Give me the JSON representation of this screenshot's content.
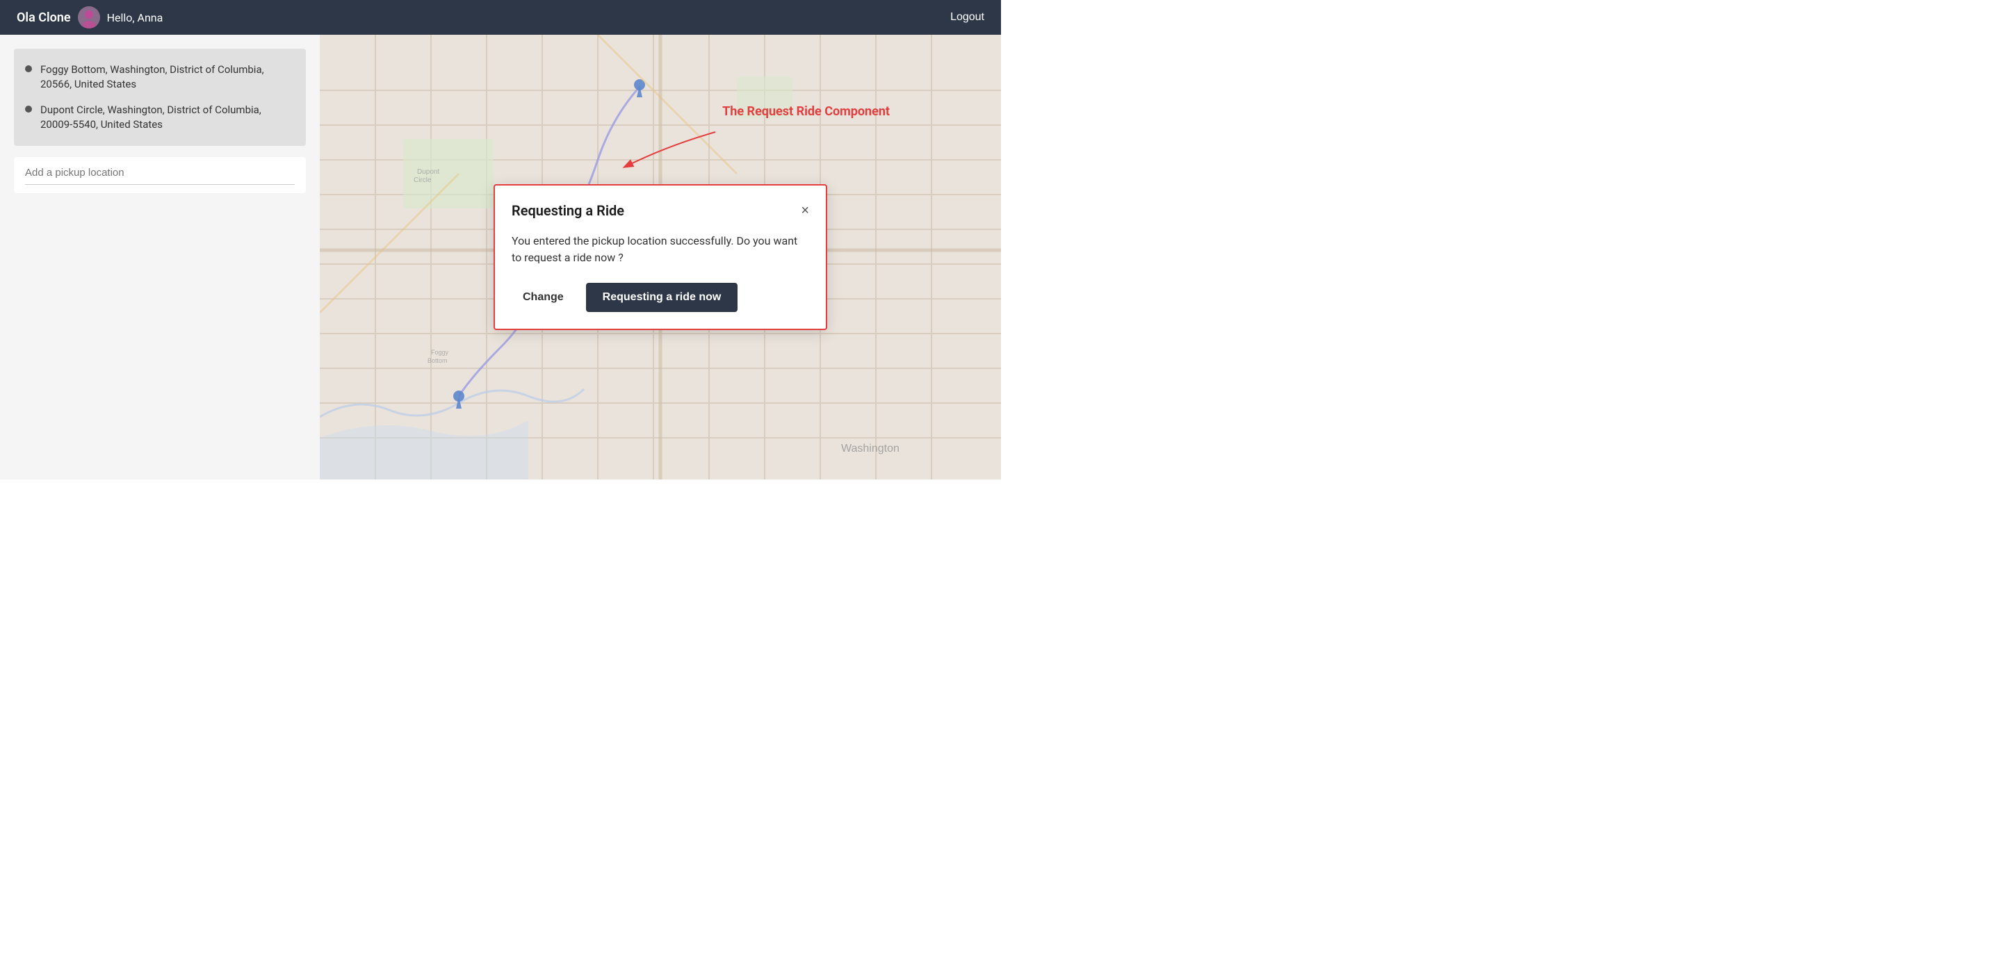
{
  "navbar": {
    "app_name": "Ola Clone",
    "greeting": "Hello, Anna",
    "logout_label": "Logout"
  },
  "sidebar": {
    "location1": "Foggy Bottom, Washington, District of Columbia, 20566, United States",
    "location2": "Dupont Circle, Washington, District of Columbia, 20009-5540, United States",
    "pickup_placeholder": "Add a pickup location"
  },
  "modal": {
    "title": "Requesting a Ride",
    "body": "You entered the pickup location successfully. Do you want to request a ride now ?",
    "change_label": "Change",
    "request_label": "Requesting a ride now",
    "close_icon": "×"
  },
  "annotation": {
    "label": "The Request Ride Component"
  },
  "map": {
    "washington_label": "Washington"
  }
}
